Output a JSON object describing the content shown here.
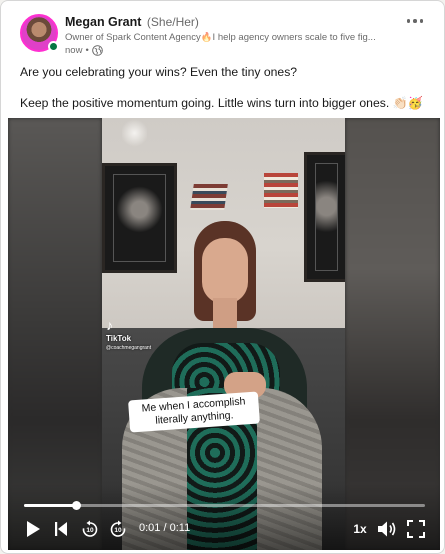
{
  "post": {
    "author": {
      "name": "Megan Grant",
      "pronouns": "(She/Her)",
      "tagline": "Owner of Spark Content Agency🔥I help agency owners scale to five fig...",
      "timestamp": "now",
      "online_color": "#057642",
      "avatar_ring_color": "#ff2fd1"
    },
    "more_menu_icon": "three-dots-icon",
    "visibility_icon": "globe-icon",
    "text": {
      "line1": "Are you celebrating your wins? Even the tiny ones?",
      "line2": "Keep the positive momentum going. Little wins turn into bigger ones. 👏🏻🥳"
    }
  },
  "video": {
    "watermark": {
      "logo": "♪",
      "name": "TikTok",
      "handle": "@coachmegangrant"
    },
    "caption": "Me when I accomplish literally anything.",
    "progress_fraction": 0.13,
    "time": {
      "current": "0:01",
      "separator": " / ",
      "duration": "0:11"
    },
    "speed": "1x",
    "icons": {
      "play": "play-icon",
      "previous": "skip-back-icon",
      "rewind": "rewind-10-icon",
      "forward": "forward-10-icon",
      "volume": "volume-icon",
      "fullscreen": "fullscreen-icon"
    }
  }
}
